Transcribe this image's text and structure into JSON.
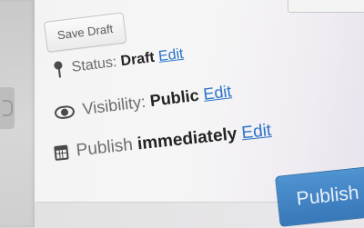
{
  "publish_box": {
    "save_draft_label": "Save Draft",
    "status": {
      "label": "Status:",
      "value": "Draft",
      "edit_label": "Edit"
    },
    "visibility": {
      "label": "Visibility:",
      "value": "Public",
      "edit_label": "Edit"
    },
    "schedule": {
      "label": "Publish",
      "value": "immediately",
      "edit_label": "Edit"
    },
    "publish_label": "Publish"
  },
  "icons": {
    "status": "pin-icon",
    "visibility": "eye-icon",
    "schedule": "calendar-icon"
  },
  "colors": {
    "link": "#2b73c8",
    "publish_button": "#3f84c6"
  }
}
